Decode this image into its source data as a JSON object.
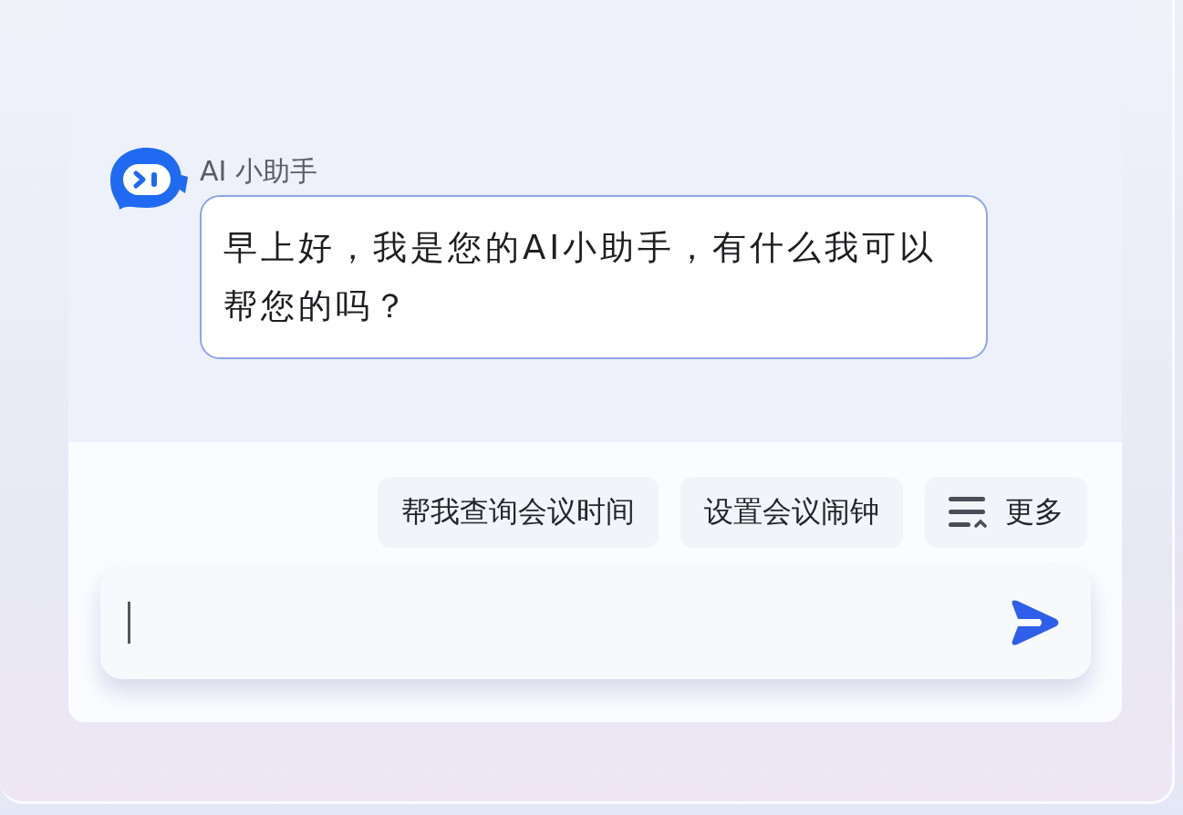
{
  "assistant_name": "AI 小助手",
  "messages": [
    {
      "kind": "assistant",
      "text": "早上好，我是您的AI小助手，有什么我可以帮您的吗？"
    }
  ],
  "suggestions": [
    {
      "kind": "prompt",
      "label": "帮我查询会议时间"
    },
    {
      "kind": "prompt",
      "label": "设置会议闹钟"
    },
    {
      "kind": "more",
      "label": "更多"
    }
  ],
  "input": {
    "focused": true
  }
}
